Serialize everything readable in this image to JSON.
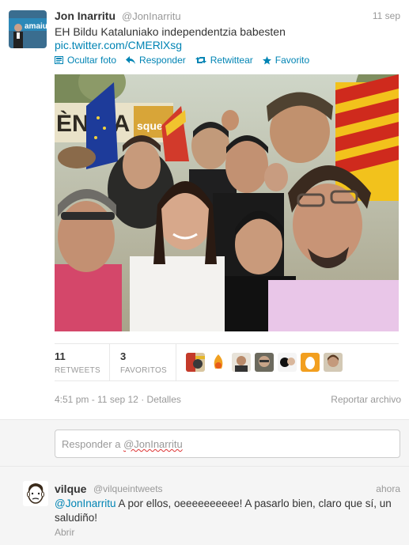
{
  "tweet": {
    "fullname": "Jon Inarritu",
    "username": "@JonInarritu",
    "time": "11 sep",
    "text": "EH Bildu Kataluniako independentzia babesten",
    "link": "pic.twitter.com/CMERlXsg",
    "avatar_caption": "amaiu"
  },
  "actions": {
    "hide_photo": "Ocultar foto",
    "reply": "Responder",
    "retweet": "Retwittear",
    "favorite": "Favorito"
  },
  "stats": {
    "retweets_count": "11",
    "retweets_label": "RETWEETS",
    "favorites_count": "3",
    "favorites_label": "FAVORITOS"
  },
  "meta": {
    "datetime": "4:51 pm - 11 sep 12",
    "details": "Detalles",
    "report": "Reportar archivo"
  },
  "photo": {
    "banner_text": "ÈNCIA",
    "banner_text2": "squerra"
  },
  "reply_box": {
    "prefix": "Responder a ",
    "mention": "@JonInarritu"
  },
  "reply": {
    "fullname": "vilque",
    "username": "@vilqueintweets",
    "time": "ahora",
    "mention": "@JonInarritu",
    "text": " A por ellos, oeeeeeeeeee! A pasarlo bien, claro que sí, un saludiño!",
    "open": "Abrir"
  },
  "colors": {
    "link": "#0084b4",
    "muted": "#999999",
    "text": "#333333"
  },
  "icons": [
    "photo-icon",
    "reply-icon",
    "retweet-icon",
    "star-icon"
  ]
}
